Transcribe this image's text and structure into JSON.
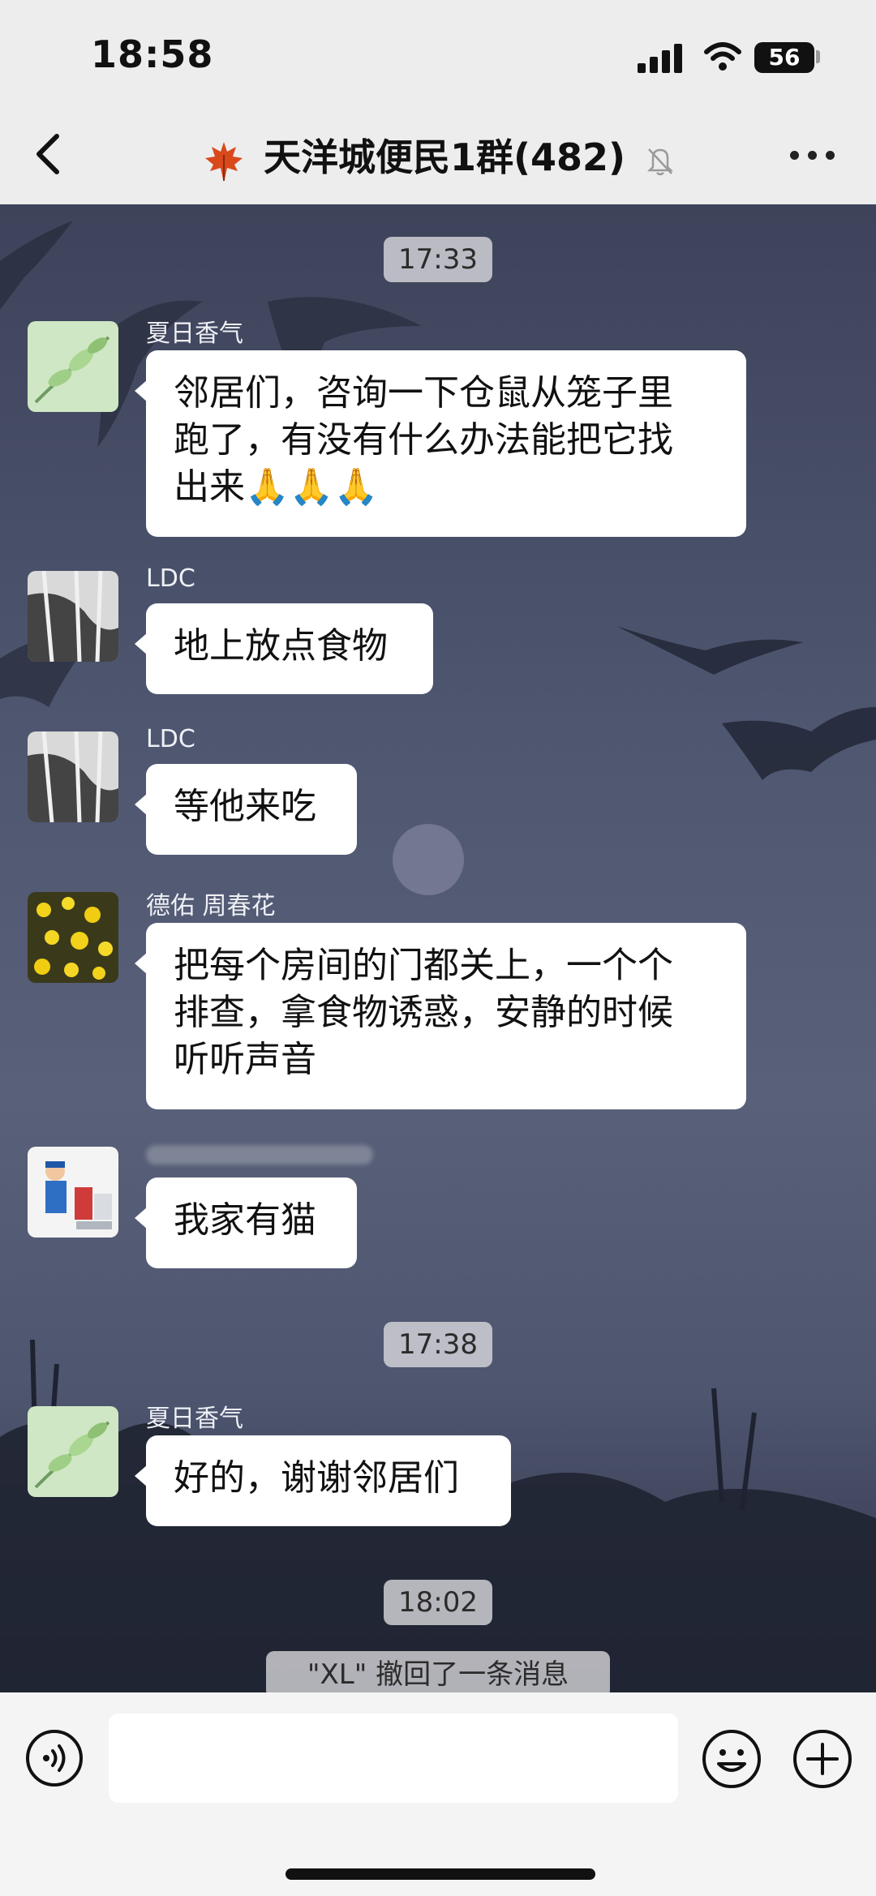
{
  "status_bar": {
    "time": "18:58",
    "battery": "56"
  },
  "header": {
    "title": "天洋城便民1群(482)"
  },
  "messages": [
    {
      "type": "time",
      "text": "17:33"
    },
    {
      "type": "msg",
      "sender": "夏日香气",
      "text": "邻居们，咨询一下仓鼠从笼子里跑了，有没有什么办法能把它找出来🙏🙏🙏",
      "lines": [
        "邻居们，咨询一下仓鼠从笼子里",
        "跑了，有没有什么办法能把它找",
        "出来🙏🙏🙏"
      ]
    },
    {
      "type": "msg",
      "sender": "LDC",
      "text": "地上放点食物"
    },
    {
      "type": "msg",
      "sender": "LDC",
      "text": "等他来吃"
    },
    {
      "type": "msg",
      "sender": "德佑 周春花",
      "text": "把每个房间的门都关上，一个个排查，拿食物诱惑，安静的时候听听声音",
      "lines": [
        "把每个房间的门都关上，一个个",
        "排查，拿食物诱惑，安静的时候",
        "听听声音"
      ]
    },
    {
      "type": "msg",
      "sender": "",
      "text": "我家有猫"
    },
    {
      "type": "time",
      "text": "17:38"
    },
    {
      "type": "msg",
      "sender": "夏日香气",
      "text": "好的，谢谢邻居们"
    },
    {
      "type": "time",
      "text": "18:02"
    },
    {
      "type": "system",
      "text": "\"XL\" 撤回了一条消息"
    }
  ],
  "input": {
    "value": "",
    "placeholder": ""
  },
  "icons": {
    "back": "chevron-left-icon",
    "more": "more-dots-icon",
    "voice": "voice-icon",
    "emoji": "emoji-icon",
    "plus": "plus-icon",
    "mute": "bell-off-icon",
    "leaf": "maple-leaf-icon"
  }
}
